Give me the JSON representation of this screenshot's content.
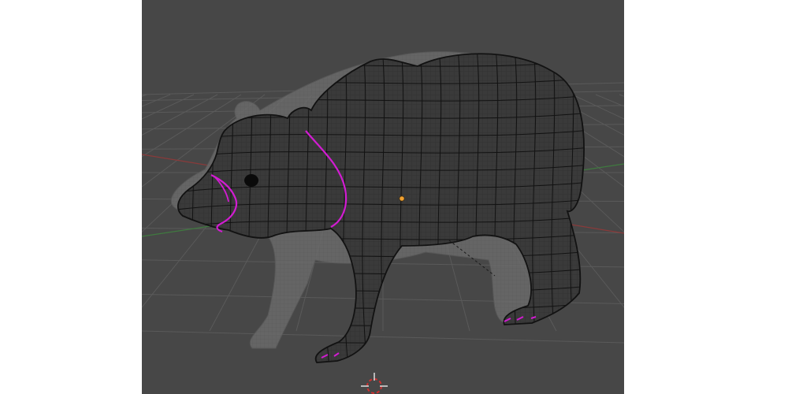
{
  "viewport": {
    "background": "#474747",
    "grid_color": "#5a5a5a",
    "x_axis_color": "#8a3a3a",
    "y_axis_color": "#3f7a3f",
    "mesh_fill": "#3a3a3a",
    "mesh_wire": "#121212",
    "ghost_fill": "#6b6b6b",
    "seam_color": "#d21cd2",
    "origin_color": "#f0a030",
    "cursor_color": "#e8e8e8",
    "cursor_accent": "#d03030"
  },
  "icons": {
    "cursor": "3d-cursor-icon",
    "origin": "object-origin-icon"
  }
}
